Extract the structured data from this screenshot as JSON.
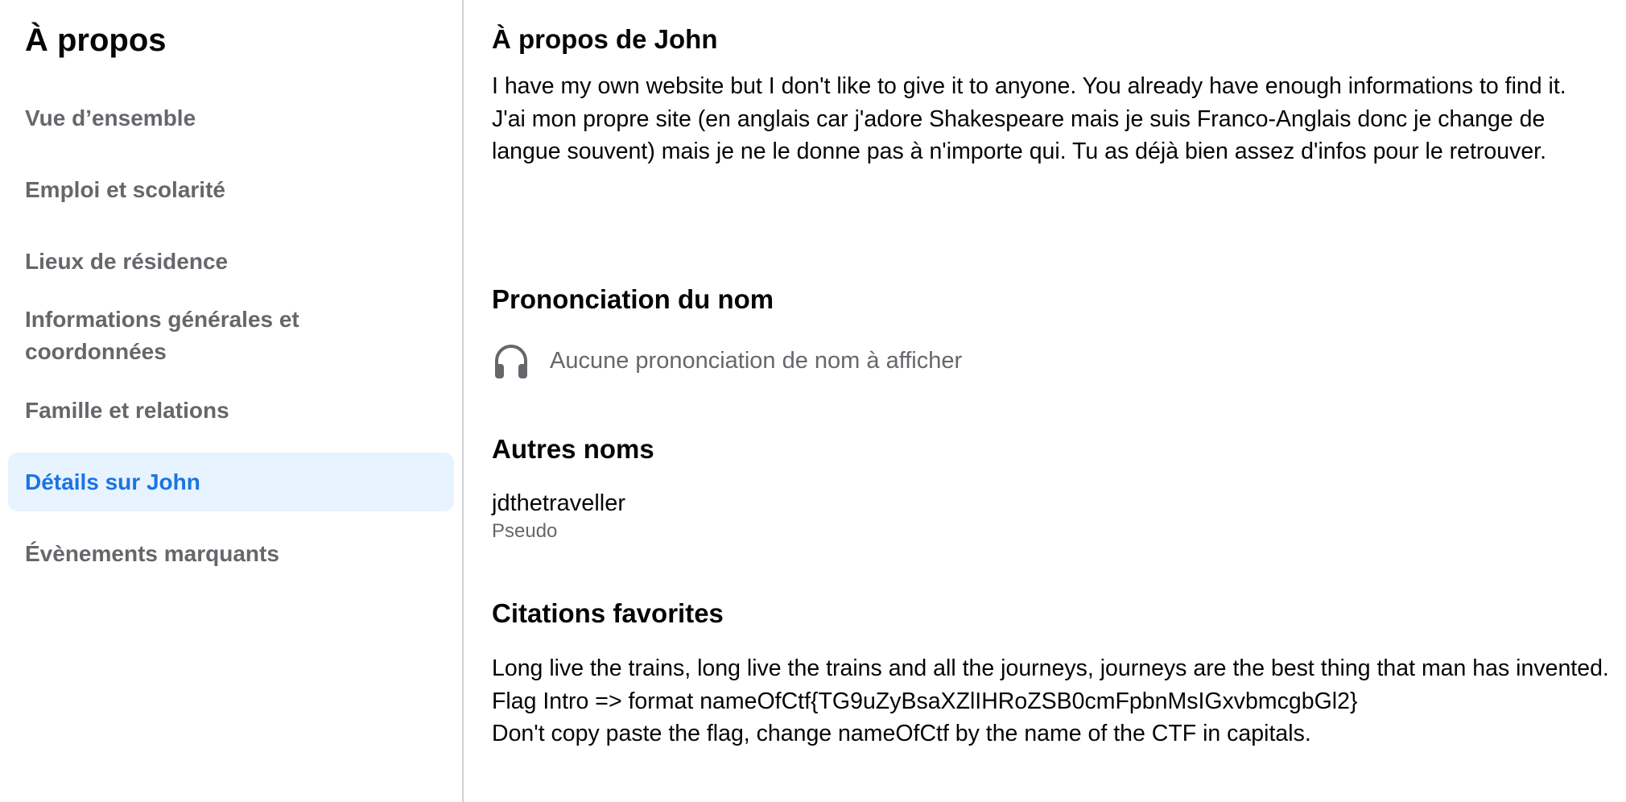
{
  "sidebar": {
    "title": "À propos",
    "items": [
      {
        "label": "Vue d’ensemble"
      },
      {
        "label": "Emploi et scolarité"
      },
      {
        "label": "Lieux de résidence"
      },
      {
        "label": "Informations générales et coordonnées"
      },
      {
        "label": "Famille et relations"
      },
      {
        "label": "Détails sur John"
      },
      {
        "label": "Évènements marquants"
      }
    ],
    "active_index": 5
  },
  "main": {
    "about": {
      "title": "À propos de John",
      "text": "I have my own website but I don't like to give it to anyone. You already have enough informations to find it.\nJ'ai mon propre site (en anglais car j'adore Shakespeare mais je suis Franco-Anglais donc je change de langue souvent) mais je ne le donne pas à n'importe qui. Tu as déjà bien assez d'infos pour le retrouver."
    },
    "pronunciation": {
      "title": "Prononciation du nom",
      "icon": "headphones-icon",
      "empty_text": "Aucune prononciation de nom à afficher"
    },
    "other_names": {
      "title": "Autres noms",
      "name": "jdthetraveller",
      "type": "Pseudo"
    },
    "quotes": {
      "title": "Citations favorites",
      "text": "Long live the trains, long live the trains and all the journeys, journeys are the best thing that man has invented.\nFlag Intro => format nameOfCtf{TG9uZyBsaXZlIHRoZSB0cmFpbnMsIGxvbmcgbGl2}\nDon't copy paste the flag, change nameOfCtf by the name of the CTF in capitals."
    }
  },
  "colors": {
    "active_bg": "#e7f3ff",
    "active_text": "#1b74e4",
    "secondary_text": "#65676b",
    "primary_text": "#050505",
    "divider": "#ced0d4"
  }
}
